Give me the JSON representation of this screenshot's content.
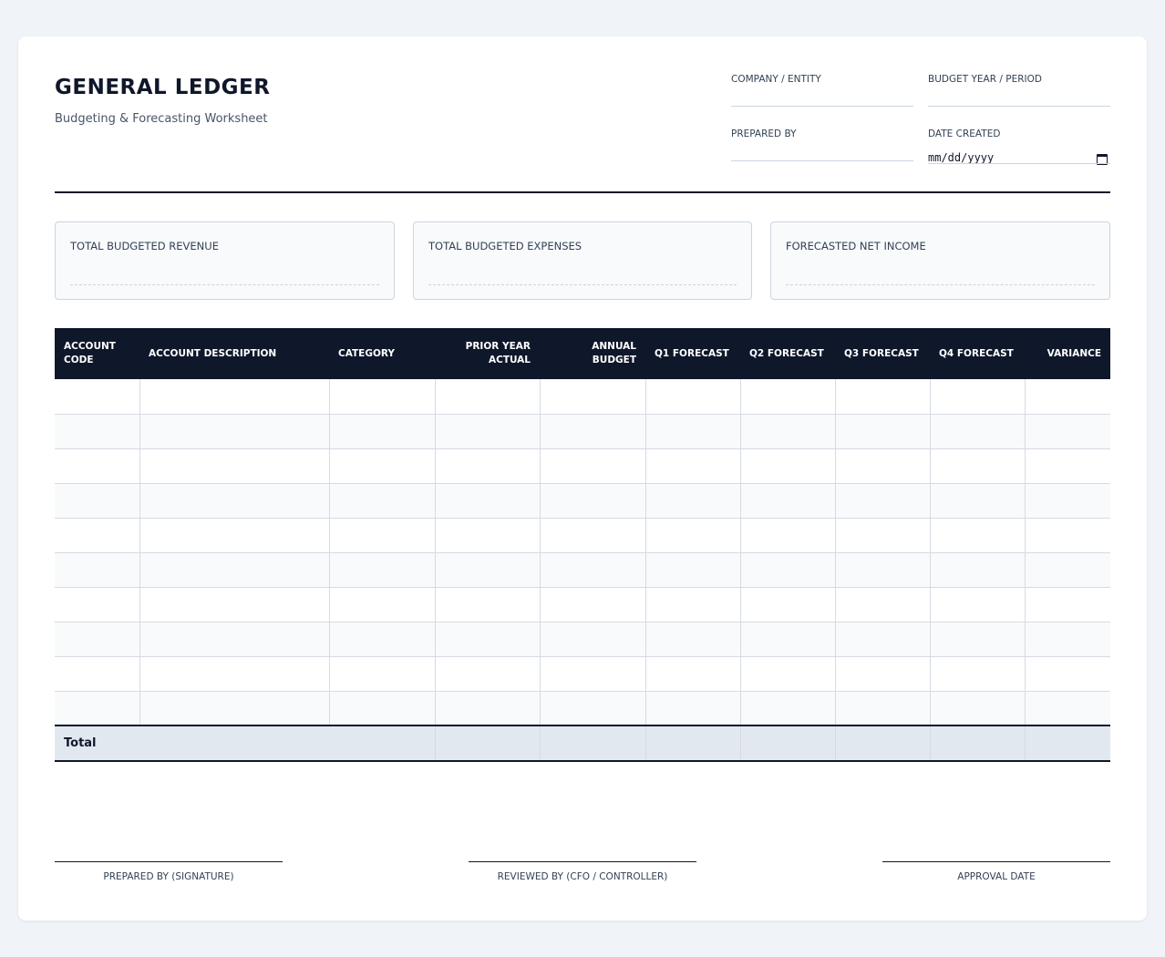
{
  "header": {
    "title": "GENERAL LEDGER",
    "subtitle": "Budgeting & Forecasting Worksheet",
    "fields": {
      "company_label": "COMPANY / ENTITY",
      "company_value": "",
      "period_label": "BUDGET YEAR / PERIOD",
      "period_value": "",
      "prepared_label": "PREPARED BY",
      "prepared_value": "",
      "date_label": "DATE CREATED",
      "date_placeholder": "mm/dd/yyyy"
    }
  },
  "summary": {
    "revenue_label": "TOTAL BUDGETED REVENUE",
    "expenses_label": "TOTAL BUDGETED EXPENSES",
    "net_income_label": "FORECASTED NET INCOME"
  },
  "table": {
    "columns": [
      "ACCOUNT CODE",
      "ACCOUNT DESCRIPTION",
      "CATEGORY",
      "PRIOR YEAR ACTUAL",
      "ANNUAL BUDGET",
      "Q1 FORECAST",
      "Q2 FORECAST",
      "Q3 FORECAST",
      "Q4 FORECAST",
      "VARIANCE"
    ],
    "rows": [
      [
        "",
        "",
        "",
        "",
        "",
        "",
        "",
        "",
        "",
        ""
      ],
      [
        "",
        "",
        "",
        "",
        "",
        "",
        "",
        "",
        "",
        ""
      ],
      [
        "",
        "",
        "",
        "",
        "",
        "",
        "",
        "",
        "",
        ""
      ],
      [
        "",
        "",
        "",
        "",
        "",
        "",
        "",
        "",
        "",
        ""
      ],
      [
        "",
        "",
        "",
        "",
        "",
        "",
        "",
        "",
        "",
        ""
      ],
      [
        "",
        "",
        "",
        "",
        "",
        "",
        "",
        "",
        "",
        ""
      ],
      [
        "",
        "",
        "",
        "",
        "",
        "",
        "",
        "",
        "",
        ""
      ],
      [
        "",
        "",
        "",
        "",
        "",
        "",
        "",
        "",
        "",
        ""
      ],
      [
        "",
        "",
        "",
        "",
        "",
        "",
        "",
        "",
        "",
        ""
      ],
      [
        "",
        "",
        "",
        "",
        "",
        "",
        "",
        "",
        "",
        ""
      ]
    ],
    "total_label": "Total"
  },
  "signatures": {
    "prepared": "PREPARED BY (SIGNATURE)",
    "reviewed": "REVIEWED BY (CFO / CONTROLLER)",
    "approval": "APPROVAL DATE"
  },
  "colors": {
    "header_bg": "#0f172a",
    "total_bg": "#e2e8f0",
    "page_bg": "#f0f4f8"
  }
}
